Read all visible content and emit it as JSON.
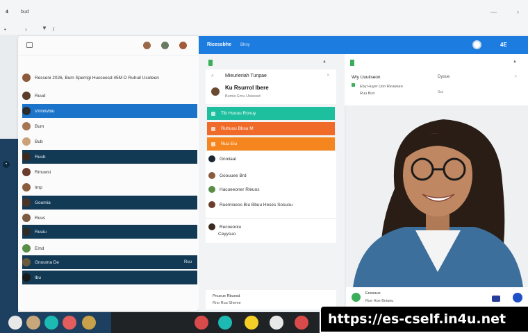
{
  "topbar": {
    "left_label": "4",
    "right_label": "bud"
  },
  "panel_list": {
    "rows": [
      {
        "label": "Resseni 2026, Bum Sperrigi Hucceesd 45M D Ruhuil Usoteen",
        "style": "plain",
        "avatar": "#8b5a3c"
      },
      {
        "label": "Ruud",
        "style": "plain",
        "avatar": "#5a3d2a"
      },
      {
        "label": "Vmmivbiu",
        "style": "blue",
        "avatar": "#2c2c2c"
      },
      {
        "label": "Bum",
        "style": "plain",
        "avatar": "#a57554"
      },
      {
        "label": "Bub",
        "style": "plain",
        "avatar": "#c9a377"
      },
      {
        "label": "Ruub",
        "style": "navy",
        "avatar": "#3b2a20"
      },
      {
        "label": "Rmuwsi",
        "style": "plain",
        "avatar": "#6b3d2c"
      },
      {
        "label": "Imp",
        "style": "plain",
        "avatar": "#8a5c3e"
      },
      {
        "label": "Goumia",
        "style": "navy",
        "avatar": "#4c3424"
      },
      {
        "label": "Ruus",
        "style": "plain",
        "avatar": "#7a5a40"
      },
      {
        "label": "Ruuiu",
        "style": "navy",
        "avatar": "#2e2b28"
      },
      {
        "label": "Emd",
        "style": "plain",
        "avatar": "#5a8e48"
      },
      {
        "label": "Gnouma De",
        "style": "navy",
        "avatar": "#6b5a3c",
        "trail": "Ruu"
      },
      {
        "label": "Ibu",
        "style": "navy",
        "avatar": "#1a1a1a"
      }
    ]
  },
  "panel_chat": {
    "header_title": "Ricessbhe",
    "header_sub": "Bhny",
    "card_label": "Mieurieriah Tunpae",
    "card_big": "Ku Rsurrol Ibere",
    "card_sub": "Bumio Emu Uisiessd",
    "bars": [
      {
        "label": "Tib Huouu Ronuy",
        "color": "#1dbf9f"
      },
      {
        "label": "Ruhuou Bbsu M",
        "color": "#f06a2a"
      },
      {
        "label": "Ruu Eiu",
        "color": "#f5861f"
      }
    ],
    "items": [
      {
        "label": "Gnoiiaal",
        "avatar": "#1c2632"
      },
      {
        "label": "Goouuee Brd",
        "avatar": "#8a5c3e"
      },
      {
        "label": "Hacueeoner Rleuos",
        "avatar": "#5a8e48"
      },
      {
        "label": "Ruemioeos Biu Bbuu Heses Sosuou",
        "avatar": "#6b3d2c"
      },
      {
        "label": "Recoeooiu",
        "avatar": "#3b2a20"
      },
      {
        "label": "Ceyysuo",
        "avatar": ""
      }
    ],
    "footer_line1": "Pnueue Rbuesd",
    "footer_line2": "Rno Ruu Sheme"
  },
  "panel_detail": {
    "header_label": "4E",
    "card_line1": "Wiy Uuuiiseon",
    "card_line2": "Eby Huyer Uon Reuwseo",
    "card_line3": "Ruu Bun",
    "card_right1": "Dyoue",
    "card_right2": "Sui"
  },
  "video_card": {
    "line1": "Enesaue",
    "line2": "Rue Hue Bniaeu"
  },
  "watermark": "https://es-cself.in4u.net",
  "dock_colors": [
    "#e8e8e8",
    "#c8a77a",
    "#1db9b3",
    "#e25d5d",
    "#c9a14a",
    "#d94b4b",
    "#1db9b3",
    "#f5cf26",
    "#e8e8e8",
    "#d94b4b",
    "#3a3a3a"
  ]
}
